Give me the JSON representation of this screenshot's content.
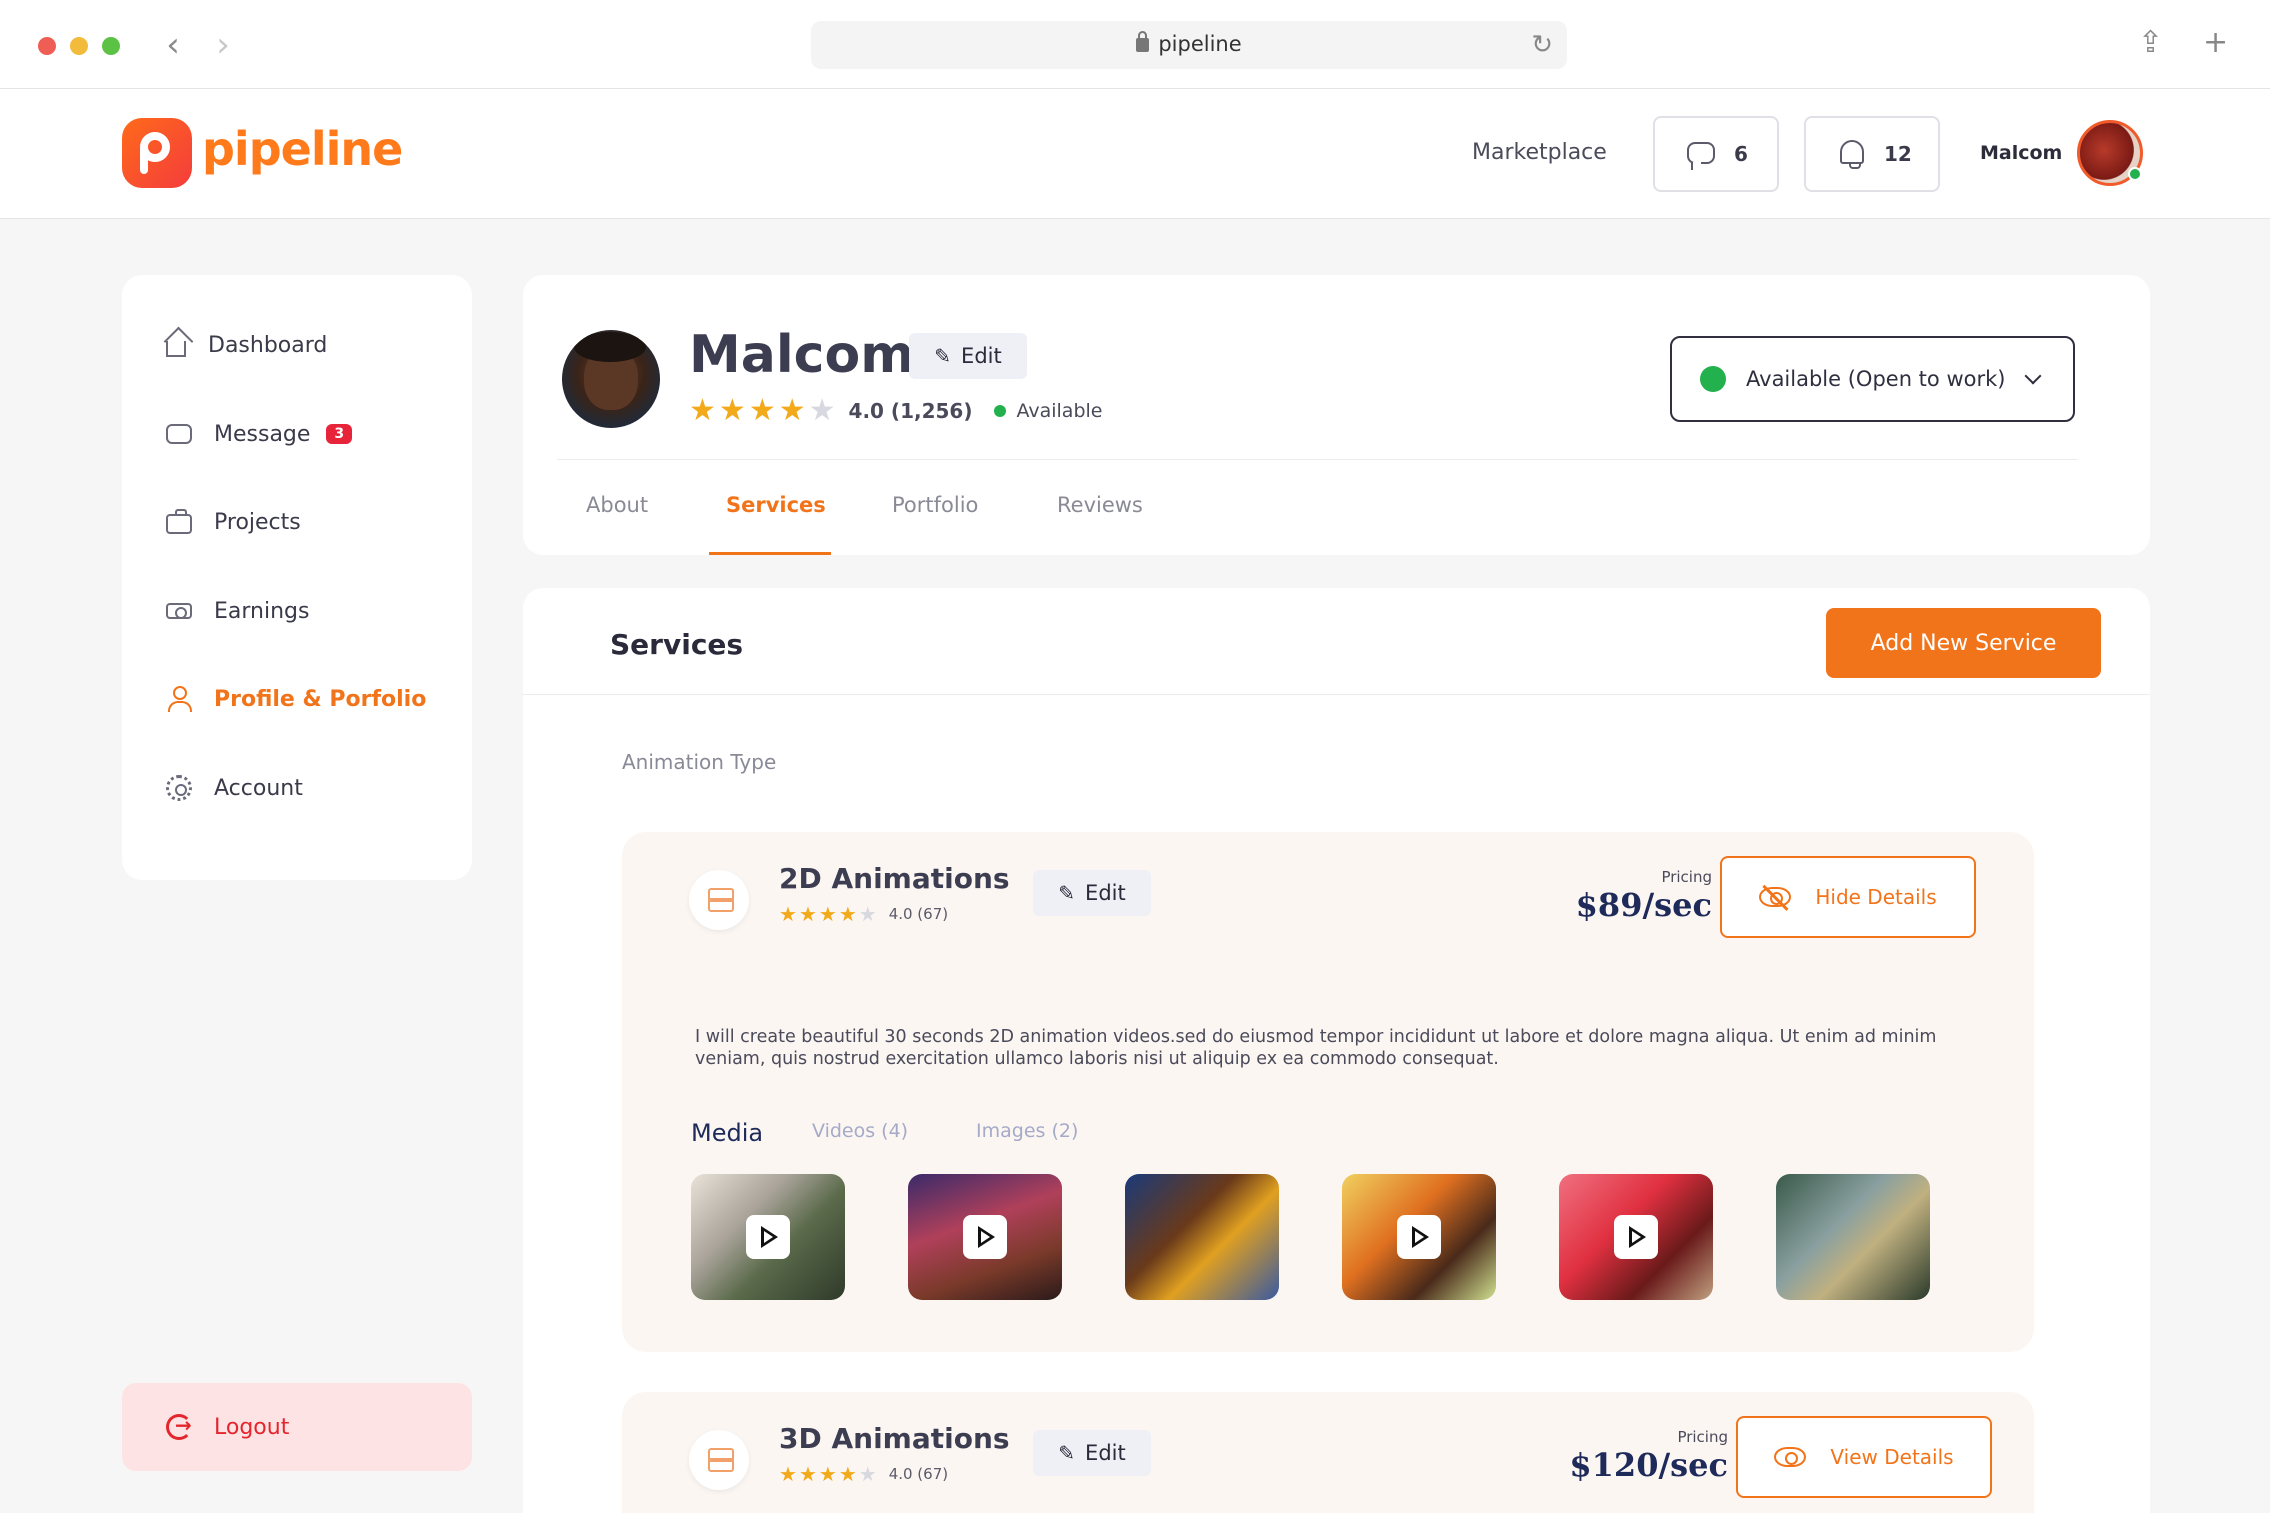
{
  "browser": {
    "url": "pipeline",
    "back_icon": "chevron-left-icon",
    "forward_icon": "chevron-right-icon"
  },
  "header": {
    "logo_text": "pipeline",
    "marketplace_label": "Marketplace",
    "messages_count": "6",
    "notifications_count": "12",
    "user_name": "Malcom"
  },
  "sidebar": {
    "items": [
      {
        "label": "Dashboard",
        "icon": "home-icon"
      },
      {
        "label": "Message",
        "icon": "message-icon",
        "badge": "3"
      },
      {
        "label": "Projects",
        "icon": "briefcase-icon"
      },
      {
        "label": "Earnings",
        "icon": "cash-icon"
      },
      {
        "label": "Profile & Porfolio",
        "icon": "user-icon",
        "active": true
      },
      {
        "label": "Account",
        "icon": "gear-icon"
      }
    ],
    "logout_label": "Logout"
  },
  "profile": {
    "name": "Malcom",
    "edit_label": "Edit",
    "rating": "4.0 (1,256)",
    "stars": 4,
    "availability": "Available",
    "status_select": "Available (Open to work)",
    "tabs": [
      "About",
      "Services",
      "Portfolio",
      "Reviews"
    ],
    "active_tab": "Services"
  },
  "services": {
    "title": "Services",
    "add_button": "Add New Service",
    "section_label": "Animation Type",
    "items": [
      {
        "name": "2D Animations",
        "edit_label": "Edit",
        "rating": "4.0 (67)",
        "stars": 4,
        "pricing_label": "Pricing",
        "price": "$89/sec",
        "details_button": "Hide Details",
        "description": "I will create beautiful 30 seconds 2D animation videos.sed do eiusmod tempor incididunt ut labore et dolore magna aliqua. Ut enim ad minim veniam, quis nostrud exercitation ullamco laboris nisi ut aliquip ex ea commodo consequat.",
        "media_label": "Media",
        "media_tabs": [
          "Videos (4)",
          "Images (2)"
        ]
      },
      {
        "name": "3D Animations",
        "edit_label": "Edit",
        "rating": "4.0 (67)",
        "stars": 4,
        "pricing_label": "Pricing",
        "price": "$120/sec",
        "details_button": "View Details"
      }
    ]
  },
  "colors": {
    "accent": "#f2741a",
    "danger": "#e3262e",
    "success": "#22b14c",
    "price": "#1e2a5a"
  }
}
